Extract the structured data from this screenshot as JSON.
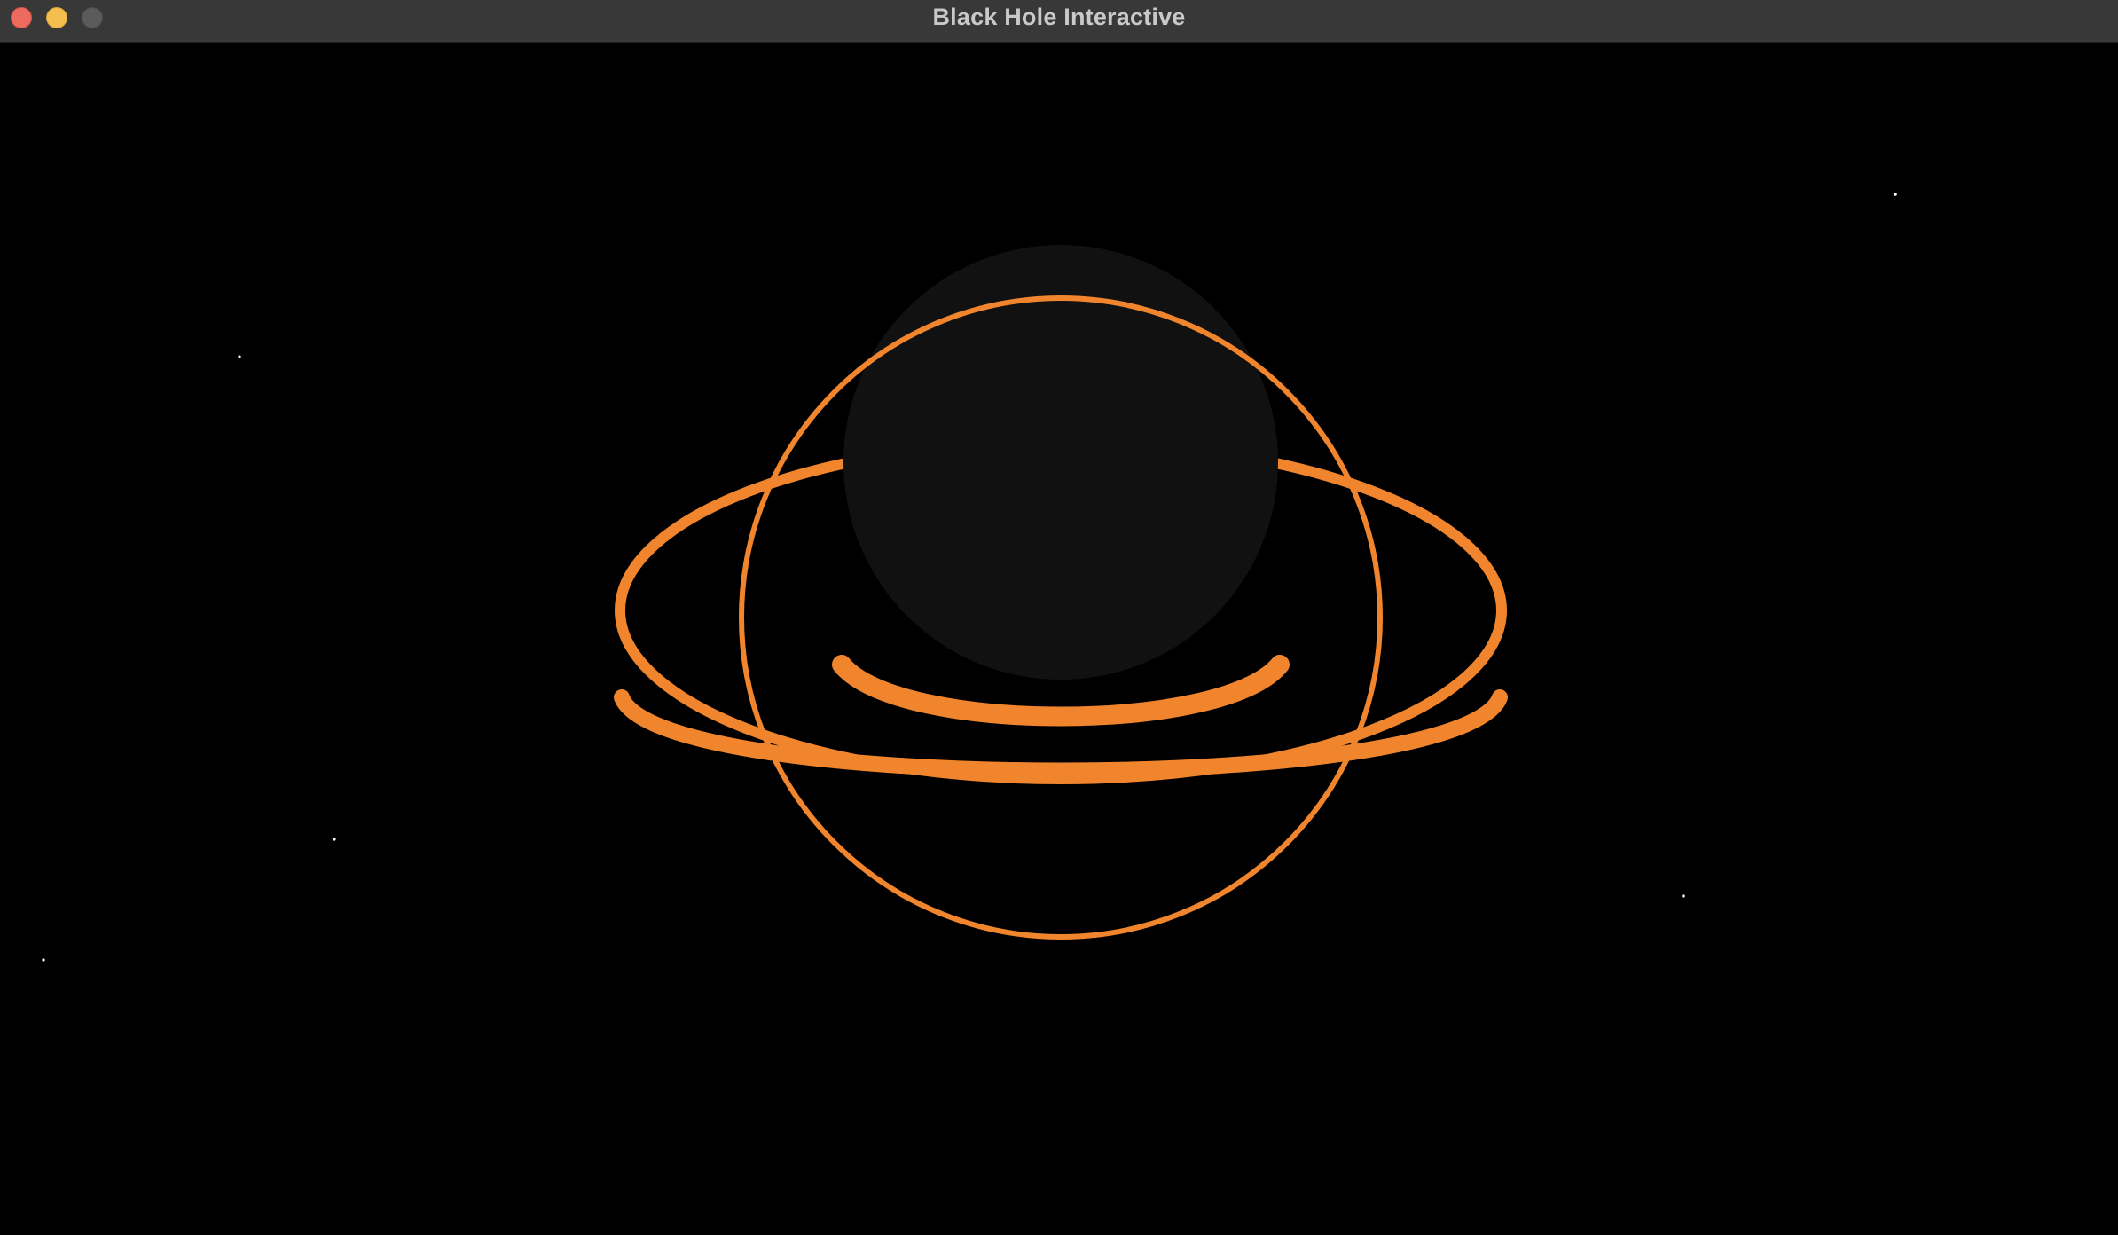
{
  "window": {
    "title": "Black Hole Interactive",
    "controls": {
      "close": "close-button",
      "minimize": "minimize-button",
      "zoom": "zoom-button"
    }
  },
  "scene": {
    "background": "#000000",
    "accent": "#f0852d",
    "sphere_color": "#111111",
    "star_color": "#ffffff"
  }
}
